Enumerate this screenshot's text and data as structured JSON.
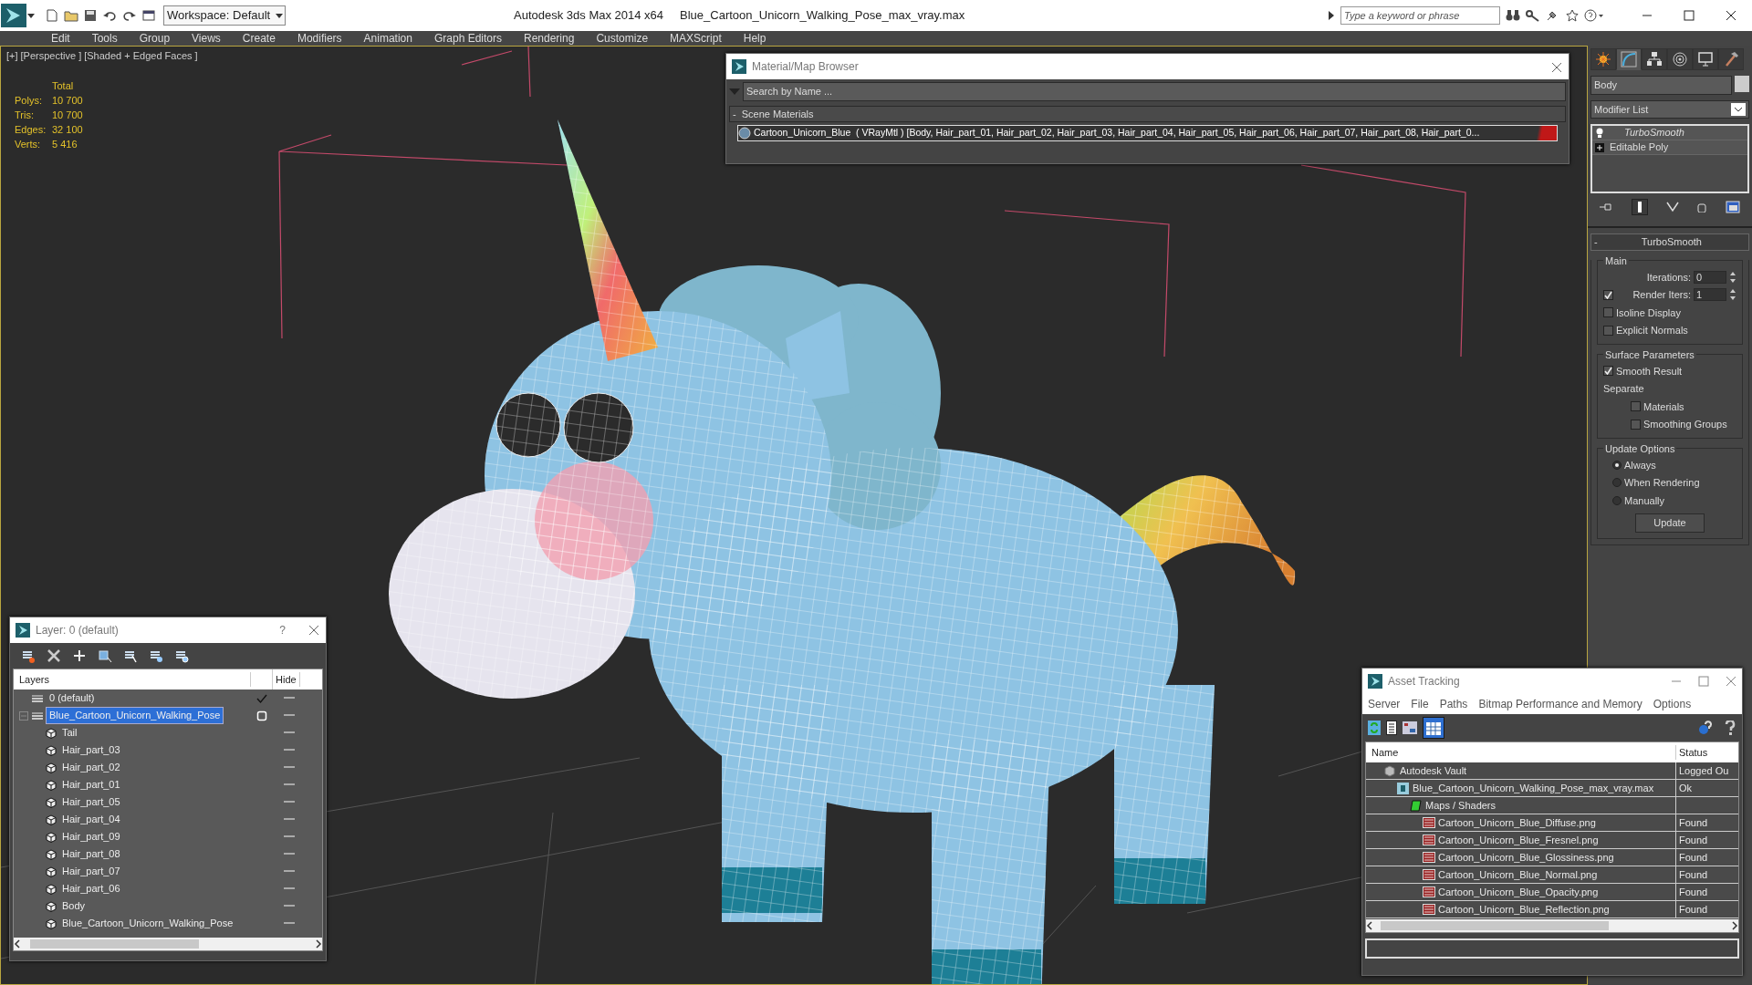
{
  "window": {
    "app_title": "Autodesk 3ds Max  2014 x64",
    "file_title": "Blue_Cartoon_Unicorn_Walking_Pose_max_vray.max",
    "workspace": "Workspace: Default",
    "search": {
      "placeholder": "Type a keyword or phrase"
    }
  },
  "menu": [
    "Edit",
    "Tools",
    "Group",
    "Views",
    "Create",
    "Modifiers",
    "Animation",
    "Graph Editors",
    "Rendering",
    "Customize",
    "MAXScript",
    "Help"
  ],
  "viewport": {
    "labels": [
      "[+]",
      "[Perspective ]",
      "[Shaded + Edged Faces ]"
    ],
    "stats": {
      "header": "Total",
      "rows": [
        {
          "label": "Polys:",
          "value": "10 700"
        },
        {
          "label": "Tris:",
          "value": "10 700"
        },
        {
          "label": "Edges:",
          "value": "32 100"
        },
        {
          "label": "Verts:",
          "value": "5 416"
        }
      ]
    }
  },
  "material_browser": {
    "title": "Material/Map Browser",
    "search": {
      "placeholder": "Search by Name ..."
    },
    "section": {
      "toggle": "-",
      "title": "Scene Materials"
    },
    "items": [
      {
        "text": "Cartoon_Unicorn_Blue  ( VRayMtl ) [Body, Hair_part_01, Hair_part_02, Hair_part_03, Hair_part_04, Hair_part_05, Hair_part_06, Hair_part_07, Hair_part_08, Hair_part_0...",
        "selected": true
      }
    ]
  },
  "command_panel": {
    "tabs": [
      {
        "kind": "star",
        "selected": false
      },
      {
        "kind": "curve",
        "selected": true
      },
      {
        "kind": "tree",
        "selected": false
      },
      {
        "kind": "rings",
        "selected": false
      },
      {
        "kind": "monitor",
        "selected": false
      },
      {
        "kind": "hammer",
        "selected": false
      }
    ],
    "object_name": "Body",
    "modifier_list": "Modifier List",
    "stack": [
      {
        "name": "TurboSmooth",
        "kind": "modifier"
      },
      {
        "name": "Editable Poly",
        "kind": "object"
      }
    ],
    "rollout": {
      "toggle": "-",
      "title": "TurboSmooth",
      "groups": [
        {
          "title": "Main",
          "controls": [
            {
              "kind": "spinner",
              "label": "Iterations:",
              "value": "0"
            },
            {
              "kind": "checkspinner",
              "label": "Render Iters:",
              "value": "1",
              "checked": true
            },
            {
              "kind": "checkbox",
              "label": "Isoline Display",
              "checked": false
            },
            {
              "kind": "checkbox",
              "label": "Explicit Normals",
              "checked": false
            }
          ]
        },
        {
          "title": "Surface Parameters",
          "controls": [
            {
              "kind": "checkbox",
              "label": "Smooth Result",
              "checked": true
            },
            {
              "kind": "label",
              "label": "Separate"
            },
            {
              "kind": "subcheckbox",
              "label": "Materials",
              "checked": false
            },
            {
              "kind": "subcheckbox",
              "label": "Smoothing Groups",
              "checked": false
            }
          ]
        },
        {
          "title": "Update Options",
          "controls": [
            {
              "kind": "radio",
              "label": "Always",
              "selected": true
            },
            {
              "kind": "radio",
              "label": "When Rendering",
              "selected": false
            },
            {
              "kind": "radio",
              "label": "Manually",
              "selected": false
            },
            {
              "kind": "button",
              "label": "Update"
            }
          ]
        }
      ]
    }
  },
  "layers": {
    "title": "Layer: 0 (default)",
    "help": "?",
    "columns": [
      "Layers",
      "Hide"
    ],
    "rows": [
      {
        "name": "0 (default)",
        "kind": "layer",
        "current": true,
        "selected": false
      },
      {
        "name": "Blue_Cartoon_Unicorn_Walking_Pose",
        "kind": "layer",
        "current": false,
        "selected": true,
        "expanded": true,
        "children": [
          {
            "name": "Tail",
            "kind": "object",
            "selected": false
          },
          {
            "name": "Hair_part_03",
            "kind": "object",
            "selected": false
          },
          {
            "name": "Hair_part_02",
            "kind": "object",
            "selected": false
          },
          {
            "name": "Hair_part_01",
            "kind": "object",
            "selected": false
          },
          {
            "name": "Hair_part_05",
            "kind": "object",
            "selected": false
          },
          {
            "name": "Hair_part_04",
            "kind": "object",
            "selected": false
          },
          {
            "name": "Hair_part_09",
            "kind": "object",
            "selected": false
          },
          {
            "name": "Hair_part_08",
            "kind": "object",
            "selected": false
          },
          {
            "name": "Hair_part_07",
            "kind": "object",
            "selected": false
          },
          {
            "name": "Hair_part_06",
            "kind": "object",
            "selected": false
          },
          {
            "name": "Body",
            "kind": "object",
            "selected": false
          },
          {
            "name": "Blue_Cartoon_Unicorn_Walking_Pose",
            "kind": "object",
            "selected": false
          }
        ]
      }
    ]
  },
  "asset_tracking": {
    "title": "Asset Tracking",
    "menu": [
      "Server",
      "File",
      "Paths",
      "Bitmap Performance and Memory",
      "Options"
    ],
    "columns": [
      "Name",
      "Status"
    ],
    "rows": [
      {
        "name": "Autodesk Vault",
        "kind": "vault",
        "status": "Logged Ou",
        "children": [
          {
            "name": "Blue_Cartoon_Unicorn_Walking_Pose_max_vray.max",
            "kind": "max",
            "status": "Ok",
            "children": [
              {
                "name": "Maps / Shaders",
                "kind": "folder",
                "children": [
                  {
                    "name": "Cartoon_Unicorn_Blue_Diffuse.png",
                    "kind": "png",
                    "status": "Found"
                  },
                  {
                    "name": "Cartoon_Unicorn_Blue_Fresnel.png",
                    "kind": "png",
                    "status": "Found"
                  },
                  {
                    "name": "Cartoon_Unicorn_Blue_Glossiness.png",
                    "kind": "png",
                    "status": "Found"
                  },
                  {
                    "name": "Cartoon_Unicorn_Blue_Normal.png",
                    "kind": "png",
                    "status": "Found"
                  },
                  {
                    "name": "Cartoon_Unicorn_Blue_Opacity.png",
                    "kind": "png",
                    "status": "Found"
                  },
                  {
                    "name": "Cartoon_Unicorn_Blue_Reflection.png",
                    "kind": "png",
                    "status": "Found"
                  }
                ]
              }
            ]
          }
        ]
      }
    ]
  }
}
